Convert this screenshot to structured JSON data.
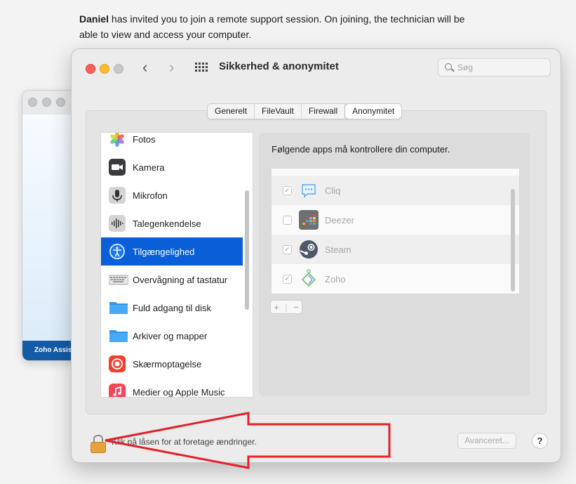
{
  "intro": {
    "inviter": "Daniel",
    "message": " has invited you to join a remote support session. On joining, the technician will be able to view and access your computer."
  },
  "background_window": {
    "footer_label": "Zoho Assis"
  },
  "window": {
    "title": "Sikkerhed & anonymitet",
    "search_placeholder": "Søg",
    "tabs": [
      "Generelt",
      "FileVault",
      "Firewall",
      "Anonymitet"
    ],
    "active_tab": "Anonymitet"
  },
  "sidebar": {
    "items": [
      {
        "label": "Fotos",
        "icon": "photos-icon"
      },
      {
        "label": "Kamera",
        "icon": "camera-icon"
      },
      {
        "label": "Mikrofon",
        "icon": "microphone-icon"
      },
      {
        "label": "Talegenkendelse",
        "icon": "speech-recognition-icon"
      },
      {
        "label": "Tilgængelighed",
        "icon": "accessibility-icon",
        "selected": true
      },
      {
        "label": "Overvågning af tastatur",
        "icon": "keyboard-icon"
      },
      {
        "label": "Fuld adgang til disk",
        "icon": "folder-icon"
      },
      {
        "label": "Arkiver og mapper",
        "icon": "folder-icon"
      },
      {
        "label": "Skærmoptagelse",
        "icon": "screen-recording-icon"
      },
      {
        "label": "Medier og Apple Music",
        "icon": "music-icon"
      }
    ]
  },
  "right_pane": {
    "description": "Følgende apps må kontrollere din computer.",
    "apps": [
      {
        "name": "Cliq",
        "checked": true,
        "icon": "cliq-icon"
      },
      {
        "name": "Deezer",
        "checked": false,
        "icon": "deezer-icon"
      },
      {
        "name": "Steam",
        "checked": true,
        "icon": "steam-icon"
      },
      {
        "name": "Zoho",
        "checked": true,
        "icon": "zoho-icon"
      }
    ],
    "add_label": "+",
    "remove_label": "−"
  },
  "bottom": {
    "lock_text": "Klik på låsen for at foretage ændringer.",
    "advanced_label": "Avanceret...",
    "help_label": "?"
  },
  "colors": {
    "selection": "#0a5ed7",
    "annotation_arrow": "#e3202a",
    "lock": "#e8a23d"
  }
}
